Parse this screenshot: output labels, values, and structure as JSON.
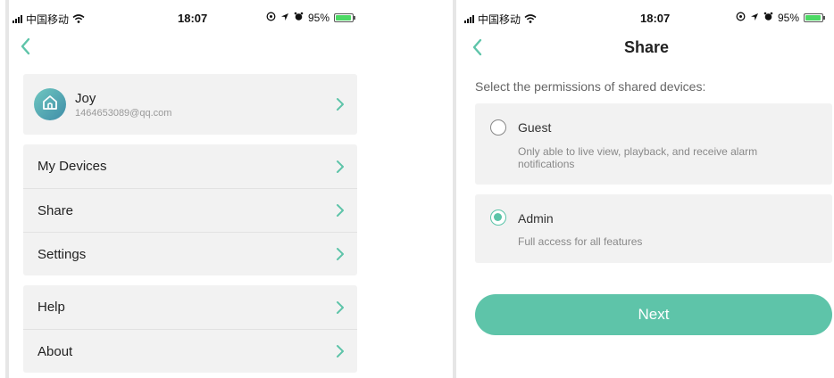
{
  "status": {
    "carrier": "中国移动",
    "time": "18:07",
    "battery": "95%"
  },
  "menu": {
    "profile": {
      "name": "Joy",
      "email": "1464653089@qq.com"
    },
    "items": [
      {
        "label": "My Devices"
      },
      {
        "label": "Share"
      },
      {
        "label": "Settings"
      },
      {
        "label": "Help"
      },
      {
        "label": "About"
      }
    ]
  },
  "share": {
    "title": "Share",
    "subtitle": "Select the permissions of shared devices:",
    "options": [
      {
        "title": "Guest",
        "description": "Only able to live view, playback, and receive alarm notifications",
        "selected": false
      },
      {
        "title": "Admin",
        "description": "Full access for all features",
        "selected": true
      }
    ],
    "next_label": "Next"
  },
  "colors": {
    "accent": "#5ec4a9",
    "card_bg": "#f2f2f2"
  }
}
